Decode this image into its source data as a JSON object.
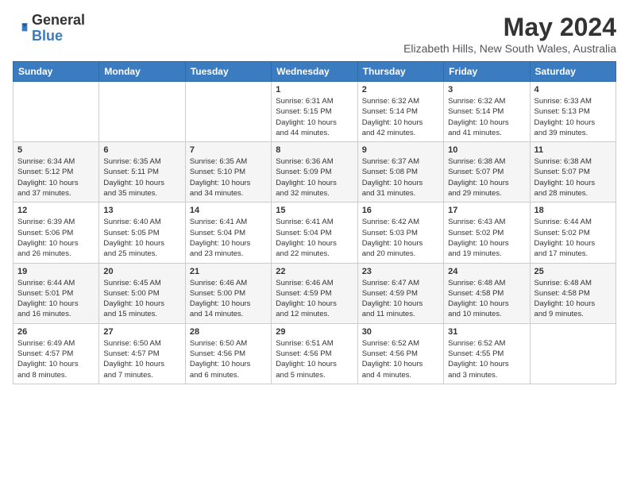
{
  "header": {
    "logo_general": "General",
    "logo_blue": "Blue",
    "month_title": "May 2024",
    "location": "Elizabeth Hills, New South Wales, Australia"
  },
  "days_of_week": [
    "Sunday",
    "Monday",
    "Tuesday",
    "Wednesday",
    "Thursday",
    "Friday",
    "Saturday"
  ],
  "weeks": [
    [
      {
        "day": "",
        "info": ""
      },
      {
        "day": "",
        "info": ""
      },
      {
        "day": "",
        "info": ""
      },
      {
        "day": "1",
        "info": "Sunrise: 6:31 AM\nSunset: 5:15 PM\nDaylight: 10 hours\nand 44 minutes."
      },
      {
        "day": "2",
        "info": "Sunrise: 6:32 AM\nSunset: 5:14 PM\nDaylight: 10 hours\nand 42 minutes."
      },
      {
        "day": "3",
        "info": "Sunrise: 6:32 AM\nSunset: 5:14 PM\nDaylight: 10 hours\nand 41 minutes."
      },
      {
        "day": "4",
        "info": "Sunrise: 6:33 AM\nSunset: 5:13 PM\nDaylight: 10 hours\nand 39 minutes."
      }
    ],
    [
      {
        "day": "5",
        "info": "Sunrise: 6:34 AM\nSunset: 5:12 PM\nDaylight: 10 hours\nand 37 minutes."
      },
      {
        "day": "6",
        "info": "Sunrise: 6:35 AM\nSunset: 5:11 PM\nDaylight: 10 hours\nand 35 minutes."
      },
      {
        "day": "7",
        "info": "Sunrise: 6:35 AM\nSunset: 5:10 PM\nDaylight: 10 hours\nand 34 minutes."
      },
      {
        "day": "8",
        "info": "Sunrise: 6:36 AM\nSunset: 5:09 PM\nDaylight: 10 hours\nand 32 minutes."
      },
      {
        "day": "9",
        "info": "Sunrise: 6:37 AM\nSunset: 5:08 PM\nDaylight: 10 hours\nand 31 minutes."
      },
      {
        "day": "10",
        "info": "Sunrise: 6:38 AM\nSunset: 5:07 PM\nDaylight: 10 hours\nand 29 minutes."
      },
      {
        "day": "11",
        "info": "Sunrise: 6:38 AM\nSunset: 5:07 PM\nDaylight: 10 hours\nand 28 minutes."
      }
    ],
    [
      {
        "day": "12",
        "info": "Sunrise: 6:39 AM\nSunset: 5:06 PM\nDaylight: 10 hours\nand 26 minutes."
      },
      {
        "day": "13",
        "info": "Sunrise: 6:40 AM\nSunset: 5:05 PM\nDaylight: 10 hours\nand 25 minutes."
      },
      {
        "day": "14",
        "info": "Sunrise: 6:41 AM\nSunset: 5:04 PM\nDaylight: 10 hours\nand 23 minutes."
      },
      {
        "day": "15",
        "info": "Sunrise: 6:41 AM\nSunset: 5:04 PM\nDaylight: 10 hours\nand 22 minutes."
      },
      {
        "day": "16",
        "info": "Sunrise: 6:42 AM\nSunset: 5:03 PM\nDaylight: 10 hours\nand 20 minutes."
      },
      {
        "day": "17",
        "info": "Sunrise: 6:43 AM\nSunset: 5:02 PM\nDaylight: 10 hours\nand 19 minutes."
      },
      {
        "day": "18",
        "info": "Sunrise: 6:44 AM\nSunset: 5:02 PM\nDaylight: 10 hours\nand 17 minutes."
      }
    ],
    [
      {
        "day": "19",
        "info": "Sunrise: 6:44 AM\nSunset: 5:01 PM\nDaylight: 10 hours\nand 16 minutes."
      },
      {
        "day": "20",
        "info": "Sunrise: 6:45 AM\nSunset: 5:00 PM\nDaylight: 10 hours\nand 15 minutes."
      },
      {
        "day": "21",
        "info": "Sunrise: 6:46 AM\nSunset: 5:00 PM\nDaylight: 10 hours\nand 14 minutes."
      },
      {
        "day": "22",
        "info": "Sunrise: 6:46 AM\nSunset: 4:59 PM\nDaylight: 10 hours\nand 12 minutes."
      },
      {
        "day": "23",
        "info": "Sunrise: 6:47 AM\nSunset: 4:59 PM\nDaylight: 10 hours\nand 11 minutes."
      },
      {
        "day": "24",
        "info": "Sunrise: 6:48 AM\nSunset: 4:58 PM\nDaylight: 10 hours\nand 10 minutes."
      },
      {
        "day": "25",
        "info": "Sunrise: 6:48 AM\nSunset: 4:58 PM\nDaylight: 10 hours\nand 9 minutes."
      }
    ],
    [
      {
        "day": "26",
        "info": "Sunrise: 6:49 AM\nSunset: 4:57 PM\nDaylight: 10 hours\nand 8 minutes."
      },
      {
        "day": "27",
        "info": "Sunrise: 6:50 AM\nSunset: 4:57 PM\nDaylight: 10 hours\nand 7 minutes."
      },
      {
        "day": "28",
        "info": "Sunrise: 6:50 AM\nSunset: 4:56 PM\nDaylight: 10 hours\nand 6 minutes."
      },
      {
        "day": "29",
        "info": "Sunrise: 6:51 AM\nSunset: 4:56 PM\nDaylight: 10 hours\nand 5 minutes."
      },
      {
        "day": "30",
        "info": "Sunrise: 6:52 AM\nSunset: 4:56 PM\nDaylight: 10 hours\nand 4 minutes."
      },
      {
        "day": "31",
        "info": "Sunrise: 6:52 AM\nSunset: 4:55 PM\nDaylight: 10 hours\nand 3 minutes."
      },
      {
        "day": "",
        "info": ""
      }
    ]
  ]
}
